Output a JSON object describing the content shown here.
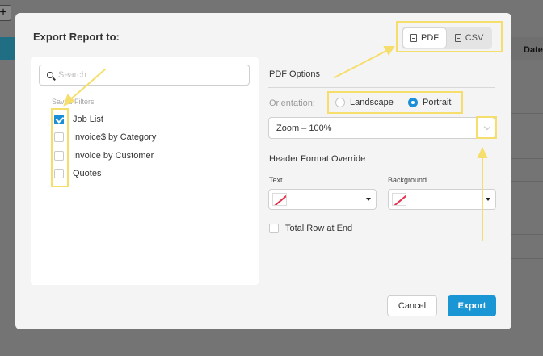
{
  "background": {
    "plus_label": "+",
    "column_header": "Date"
  },
  "modal": {
    "title": "Export Report to:",
    "formats": [
      {
        "label": "PDF",
        "icon": "document-icon",
        "active": true
      },
      {
        "label": "CSV",
        "icon": "document-icon",
        "active": false
      }
    ],
    "search": {
      "placeholder": "Search",
      "value": ""
    },
    "saved_filters_label": "Saved Filters",
    "filters": [
      {
        "label": "Job List",
        "checked": true
      },
      {
        "label": "Invoice$ by Category",
        "checked": false
      },
      {
        "label": "Invoice by Customer",
        "checked": false
      },
      {
        "label": "Quotes",
        "checked": false
      }
    ],
    "pdf_options_title": "PDF Options",
    "orientation_label": "Orientation:",
    "orientations": [
      {
        "label": "Landscape",
        "selected": false
      },
      {
        "label": "Portrait",
        "selected": true
      }
    ],
    "zoom_value": "Zoom – 100%",
    "header_format_title": "Header Format Override",
    "text_label": "Text",
    "background_label": "Background",
    "total_row_label": "Total Row at End",
    "total_row_checked": false,
    "cancel_label": "Cancel",
    "export_label": "Export"
  },
  "colors": {
    "accent": "#1a96d4",
    "highlight": "#f5de6b",
    "swatch_none": "#e5314a"
  }
}
